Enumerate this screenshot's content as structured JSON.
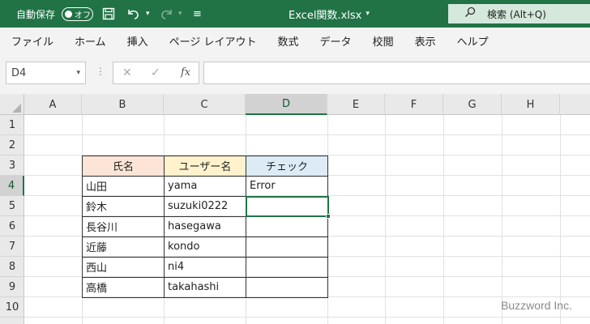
{
  "titlebar": {
    "autosave_label": "自動保存",
    "autosave_state": "オフ",
    "document_title": "Excel関数.xlsx",
    "search_text": "検索 (Alt+Q)"
  },
  "menu": [
    "ファイル",
    "ホーム",
    "挿入",
    "ページ レイアウト",
    "数式",
    "データ",
    "校閲",
    "表示",
    "ヘルプ"
  ],
  "formula_bar": {
    "name_box": "D4",
    "formula": ""
  },
  "grid": {
    "columns": [
      "A",
      "B",
      "C",
      "D",
      "E",
      "F",
      "G",
      "H"
    ],
    "rows": [
      "1",
      "2",
      "3",
      "4",
      "5",
      "6",
      "7",
      "8",
      "9",
      "10"
    ],
    "selected_column": "D",
    "selected_row": "4"
  },
  "table": {
    "headers": [
      "氏名",
      "ユーザー名",
      "チェック"
    ],
    "header_colors": [
      "#fce4d6",
      "#fff2cc",
      "#ddebf7"
    ],
    "rows": [
      [
        "山田",
        "yama",
        "Error"
      ],
      [
        "鈴木",
        "suzuki0222",
        ""
      ],
      [
        "長谷川",
        "hasegawa",
        ""
      ],
      [
        "近藤",
        "kondo",
        ""
      ],
      [
        "西山",
        "ni4",
        ""
      ],
      [
        "高橋",
        "takahashi",
        ""
      ]
    ]
  },
  "watermark": "Buzzword Inc.",
  "colors": {
    "excel_green": "#217346",
    "ribbon_bg": "#f3f3f3"
  },
  "icons": [
    "save-icon",
    "undo-icon",
    "redo-icon",
    "search-icon",
    "cancel-icon",
    "enter-icon",
    "function-icon"
  ]
}
